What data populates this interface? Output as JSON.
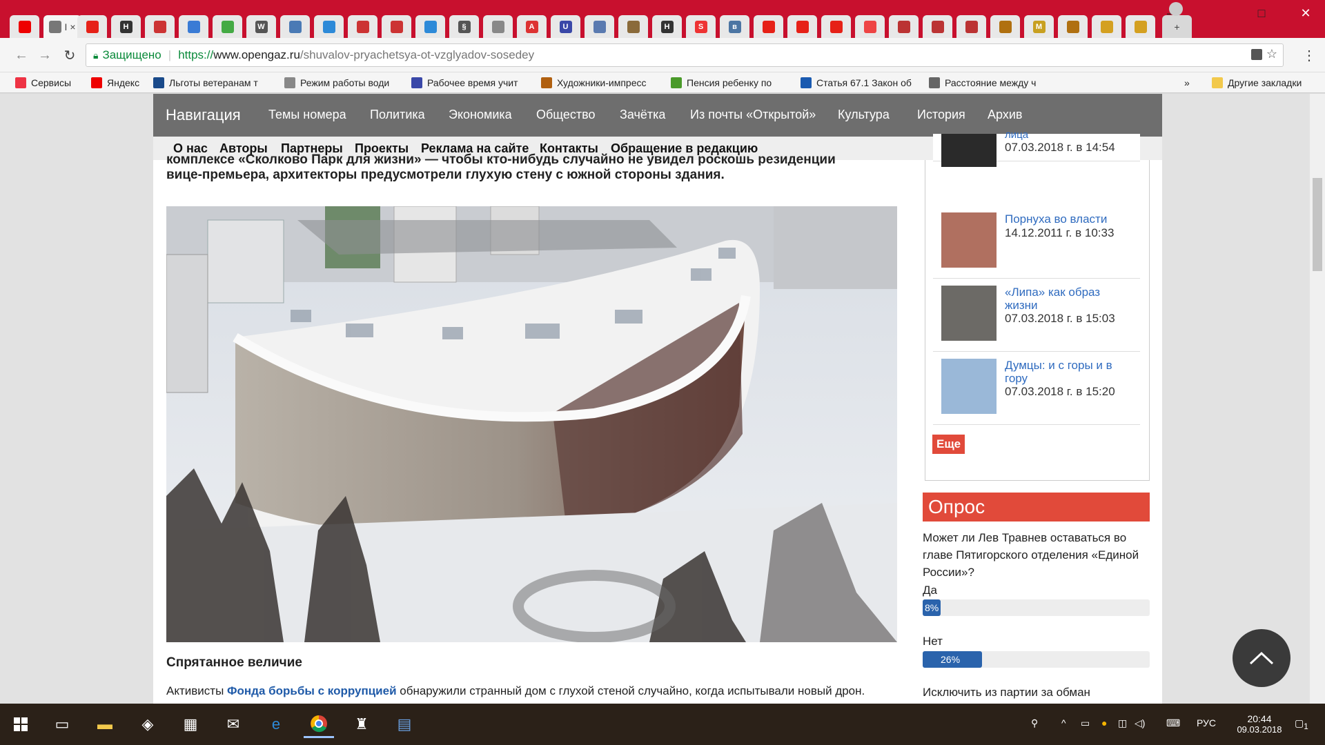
{
  "browser": {
    "tabs_favicons": [
      "yandex",
      "page",
      "youtube",
      "hh",
      "mail",
      "shield",
      "chrome",
      "wikipedia",
      "globe",
      "edge",
      "mail",
      "mail",
      "edge",
      "law",
      "court",
      "pdf",
      "u",
      "people",
      "gov",
      "hh",
      "search",
      "vk",
      "youtube",
      "youtube",
      "youtube",
      "pocket",
      "game",
      "game",
      "game",
      "box",
      "m",
      "coin",
      "emblem",
      "emblem"
    ],
    "active_tab_label": "I",
    "new_tab": "+",
    "window_controls": {
      "minimize": "—",
      "maximize": "□",
      "close": "✕"
    },
    "secure_label": "Защищено",
    "url_scheme": "https://",
    "url_host": "www.opengaz.ru",
    "url_path": "/shuvalov-pryachetsya-ot-vzglyadov-sosedey",
    "bookmarks": [
      {
        "label": "Сервисы",
        "icon": "apps-icon",
        "color": "#e34"
      },
      {
        "label": "Яндекс",
        "icon": "yandex-icon",
        "color": "#e00"
      },
      {
        "label": "Льготы ветеранам т",
        "icon": "hc-icon",
        "color": "#1a4a8a"
      },
      {
        "label": "Режим работы води",
        "icon": "doc-icon",
        "color": "#888"
      },
      {
        "label": "Рабочее время учит",
        "icon": "u-icon",
        "color": "#3a48a8"
      },
      {
        "label": "Художники-импресс",
        "icon": "art-icon",
        "color": "#b06010"
      },
      {
        "label": "Пенсия ребенку по",
        "icon": "star-icon",
        "color": "#4a9a2a"
      },
      {
        "label": "Статья 67.1 Закон об",
        "icon": "three-icon",
        "color": "#1a5ab0"
      },
      {
        "label": "Расстояние между ч",
        "icon": "car-icon",
        "color": "#666"
      }
    ],
    "bookmarks_more": "»",
    "other_bookmarks": "Другие закладки"
  },
  "site": {
    "nav": [
      "Навигация",
      "Темы номера",
      "Политика",
      "Экономика",
      "Общество",
      "Зачётка",
      "Из почты «Открытой»",
      "Культура",
      "История",
      "Архив"
    ],
    "subnav": [
      "О нас",
      "Авторы",
      "Партнеры",
      "Проекты",
      "Реклама на сайте",
      "Контакты",
      "Обращение в редакцию"
    ]
  },
  "article": {
    "lead_line1": "комплексе «Сколково Парк для жизни» — чтобы кто-нибудь случайно не увидел роскошь резиденции",
    "lead_line2": "вице-премьера, архитекторы предусмотрели глухую стену с южной стороны здания.",
    "section_title": "Спрятанное величие",
    "para_start": "Активисты ",
    "para_link": "Фонда борьбы с коррупцией",
    "para_end": " обнаружили странный дом с глухой стеной случайно, когда испытывали новый дрон."
  },
  "sidebar": {
    "items": [
      {
        "title": "лица",
        "date": "07.03.2018 г. в 14:54"
      },
      {
        "title": "Порнуха во власти",
        "date": "14.12.2011 г. в 10:33"
      },
      {
        "title": "«Липа» как образ жизни",
        "date": "07.03.2018 г. в 15:03"
      },
      {
        "title": "Думцы: и с горы и в гору",
        "date": "07.03.2018 г. в 15:20"
      }
    ],
    "more": "Еще"
  },
  "poll": {
    "title": "Опрос",
    "question": "Может ли Лев Травнев оставаться во главе Пятигорского отделения «Единой России»?",
    "options": [
      {
        "label": "Да",
        "pct": "8%",
        "value": 8
      },
      {
        "label": "Нет",
        "pct": "26%",
        "value": 26
      },
      {
        "label": "Исключить из партии за обман",
        "pct": "",
        "value": 0
      }
    ]
  },
  "taskbar": {
    "lang": "РУС",
    "time": "20:44",
    "date": "09.03.2018",
    "notifications": "1"
  }
}
